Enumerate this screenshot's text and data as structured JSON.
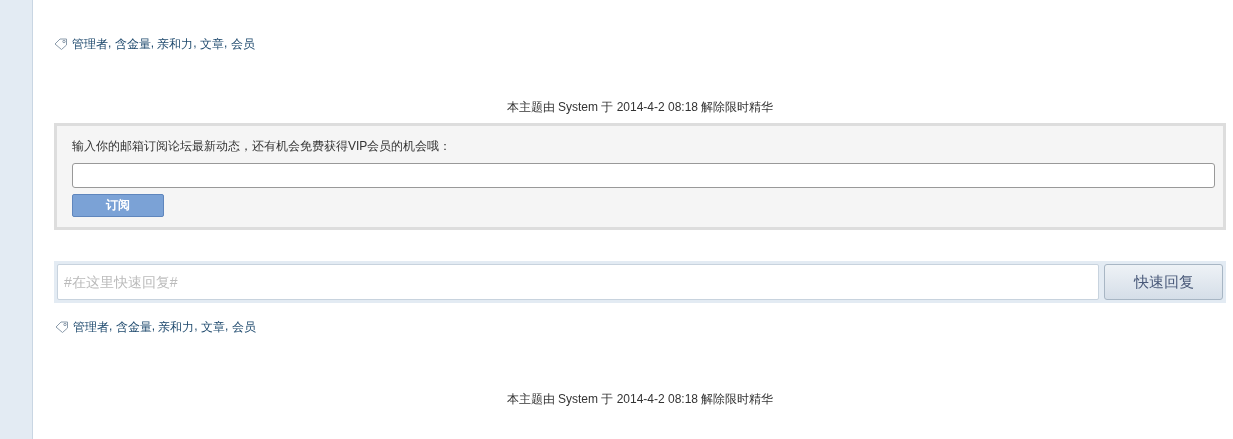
{
  "tags_top": {
    "separator": ", ",
    "items": [
      {
        "label": "管理者"
      },
      {
        "label": "含金量"
      },
      {
        "label": "亲和力"
      },
      {
        "label": "文章"
      },
      {
        "label": "会员"
      }
    ]
  },
  "notice_top": "本主题由 System 于 2014-4-2 08:18 解除限时精华",
  "subscribe": {
    "prompt": "输入你的邮箱订阅论坛最新动态，还有机会免费获得VIP会员的机会哦：",
    "button": "订阅"
  },
  "quick_reply": {
    "placeholder": "#在这里快速回复#",
    "button": "快速回复"
  },
  "tags_bottom": {
    "separator": ", ",
    "items": [
      {
        "label": "管理者"
      },
      {
        "label": "含金量"
      },
      {
        "label": "亲和力"
      },
      {
        "label": "文章"
      },
      {
        "label": "会员"
      }
    ]
  },
  "notice_bottom": "本主题由 System 于 2014-4-2 08:18 解除限时精华"
}
